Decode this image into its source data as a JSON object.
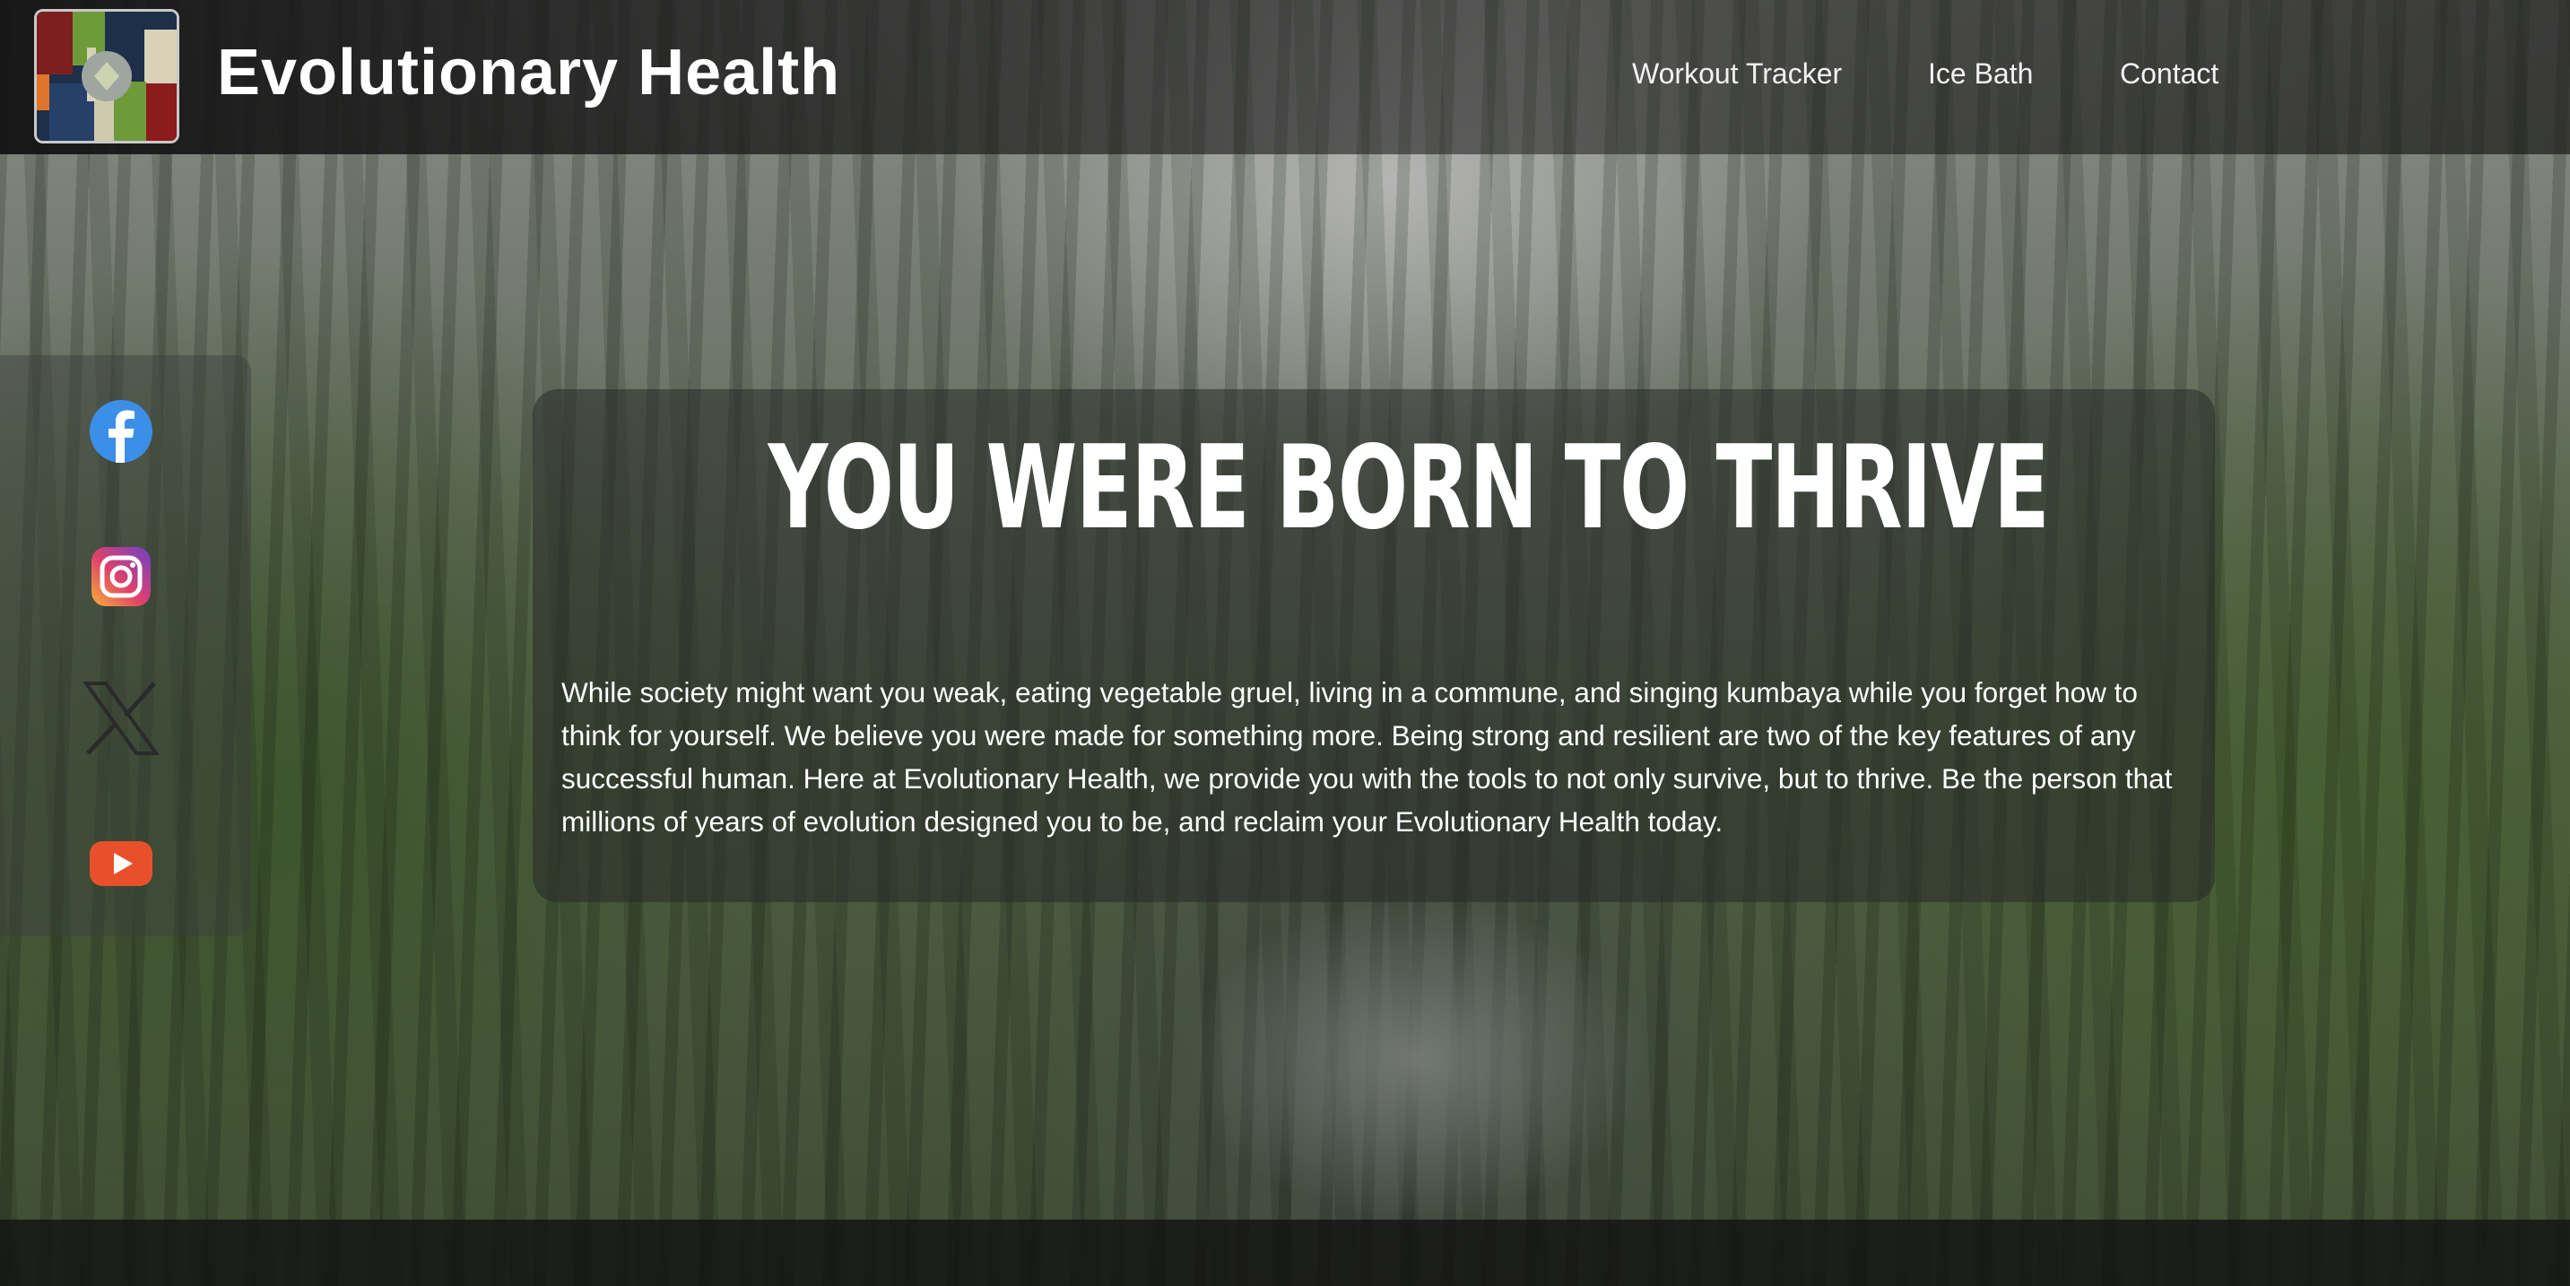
{
  "header": {
    "brand": "Evolutionary Health",
    "nav": [
      {
        "label": "Workout Tracker"
      },
      {
        "label": "Ice Bath"
      },
      {
        "label": "Contact"
      }
    ]
  },
  "social": [
    {
      "name": "facebook",
      "icon": "facebook-icon",
      "color": "#3b8fe6"
    },
    {
      "name": "instagram",
      "icon": "instagram-icon",
      "color": "#d6397b"
    },
    {
      "name": "x",
      "icon": "x-icon",
      "color": "#2a2a2a"
    },
    {
      "name": "youtube",
      "icon": "youtube-icon",
      "color": "#e8502c"
    }
  ],
  "hero": {
    "title": "YOU WERE BORN TO THRIVE",
    "body": "While society might want you weak, eating vegetable gruel, living in a commune, and singing kumbaya while you forget how to think for yourself. We believe you were made for something more. Being strong and resilient are two of the key features of any successful human. Here at Evolutionary Health, we provide you with the tools to not only survive, but to thrive. Be the person that millions of years of evolution designed you to be, and reclaim your Evolutionary Health today."
  },
  "colors": {
    "header_bg": "#1c1c1c",
    "text": "#ffffff",
    "card_bg": "#2a2c2a"
  }
}
